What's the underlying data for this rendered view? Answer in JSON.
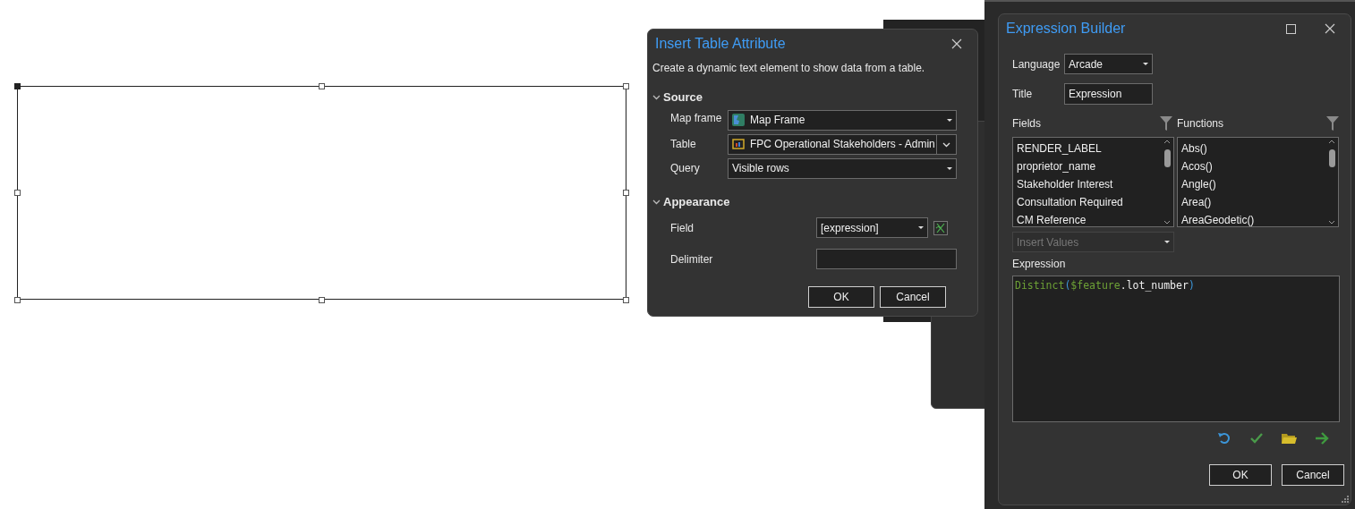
{
  "insert_dialog": {
    "title": "Insert Table Attribute",
    "description": "Create a dynamic text element to show data from a table.",
    "sections": [
      {
        "label": "Source",
        "expanded": true,
        "rows": [
          {
            "kind": "map-combo",
            "label": "Map frame",
            "value": "Map Frame"
          },
          {
            "kind": "table-split",
            "label": "Table",
            "value": "FPC Operational Stakeholders - Admin"
          },
          {
            "kind": "combo",
            "label": "Query",
            "value": "Visible rows"
          }
        ]
      },
      {
        "label": "Appearance",
        "expanded": true,
        "rows": [
          {
            "kind": "field-combo",
            "label": "Field",
            "value": "[expression]"
          },
          {
            "kind": "text",
            "label": "Delimiter"
          }
        ]
      }
    ],
    "buttons": [
      "OK",
      "Cancel"
    ]
  },
  "expression_builder": {
    "title": "Expression Builder",
    "language": {
      "label": "Language",
      "value": "Arcade"
    },
    "title_field": {
      "label": "Title",
      "value": "Expression"
    },
    "fields": {
      "label": "Fields",
      "items": [
        "RENDER_LABEL",
        "proprietor_name",
        "Stakeholder Interest",
        "Consultation Required",
        "CM Reference"
      ]
    },
    "functions": {
      "label": "Functions",
      "items": [
        "Abs()",
        "Acos()",
        "Angle()",
        "Area()",
        "AreaGeodetic()"
      ]
    },
    "insert_values": {
      "placeholder": "Insert Values",
      "disabled": true
    },
    "expression_label": "Expression",
    "code": [
      {
        "kind": "function",
        "text": "Distinct"
      },
      {
        "kind": "paren",
        "text": "("
      },
      {
        "kind": "variable",
        "text": "$feature"
      },
      {
        "kind": "plain",
        "text": ".lot_number"
      },
      {
        "kind": "paren",
        "text": ")"
      }
    ],
    "buttons": [
      "OK",
      "Cancel"
    ]
  }
}
